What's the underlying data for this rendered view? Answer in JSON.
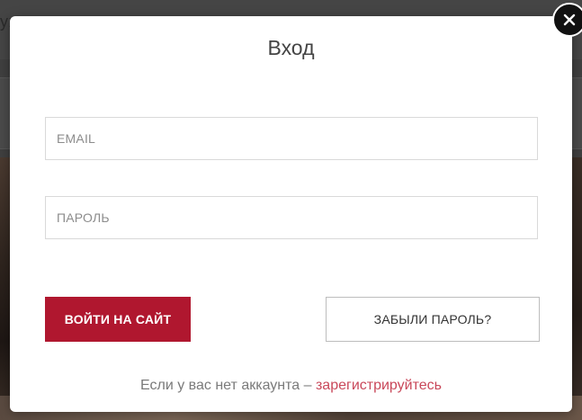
{
  "background": {
    "partial_text": "ух"
  },
  "modal": {
    "title": "Вход",
    "email_placeholder": "EMAIL",
    "password_placeholder": "ПАРОЛЬ",
    "login_button_label": "ВОЙТИ НА САЙТ",
    "forgot_button_label": "ЗАБЫЛИ ПАРОЛЬ?",
    "register_prompt": "Если у вас нет аккаунта – ",
    "register_link": "зарегистрируйтесь"
  },
  "close": {
    "icon": "close-icon"
  },
  "colors": {
    "accent": "#b0172f",
    "link": "#c9485a",
    "overlay": "#3f3f3f"
  }
}
